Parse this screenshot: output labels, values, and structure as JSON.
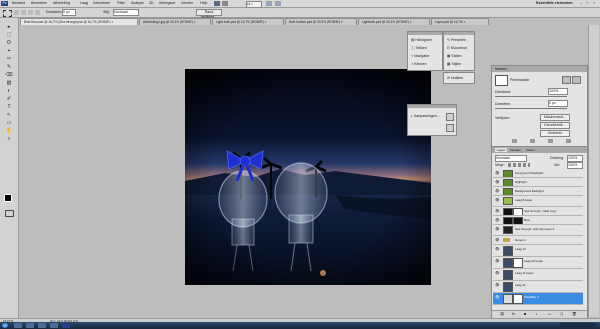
{
  "menubar": {
    "items": [
      "Bestand",
      "Bewerken",
      "Afbeelding",
      "Laag",
      "Selecteren",
      "Filter",
      "Analyse",
      "3D",
      "Weergave",
      "Venster",
      "Help"
    ],
    "workspace": "Essentiële elementen"
  },
  "options": {
    "feather_label": "Doezelen:",
    "feather_value": "0 px",
    "style_label": "Stijl:",
    "style_value": "Normaal",
    "refine_label": "Rand verfijnen..."
  },
  "tabs": [
    {
      "label": "Blue Bow.psd @ 16,7% (Sea through.psd @ 16,7% (RGB/8*) ×"
    },
    {
      "label": "Afbeelding1.jpg @ 33,3% (RGB/8*) ×"
    },
    {
      "label": "Light bulb.psd @ 16,7% (RGB/8*) ×"
    },
    {
      "label": "Bulb bottom.psd @ 33,3% (RGB/8*) ×"
    },
    {
      "label": "Lightbulb.psd @ 33,3% (RGB/8*) ×"
    },
    {
      "label": "Layer.psd @ 16,7% ×"
    }
  ],
  "tools": [
    "▸",
    "⬚",
    "ʘ",
    "⌖",
    "✂",
    "✎",
    "⌫",
    "▧",
    "◐",
    "✐",
    "T",
    "↖",
    "▭",
    "✋",
    "⌕"
  ],
  "mini_panel_a": {
    "items": [
      "Histogram",
      "Tekken",
      "Navigator",
      "Kleuren"
    ]
  },
  "mini_panel_b": {
    "items": [
      "Penselen",
      "Kloonbron",
      "Stalen",
      "Stijlen"
    ]
  },
  "mini_panel_c": {
    "items": [
      "Notities"
    ]
  },
  "adjust_float": {
    "label": "Aanpassingen..."
  },
  "masks_panel": {
    "title": "Maskers",
    "mode": "Pixelmasker",
    "density_label": "Dichtheid:",
    "density_value": "100%",
    "feather_label": "Doezelen:",
    "feather_value": "0 px",
    "refine_label": "Verfijnen:",
    "buttons": [
      "Maskerrand...",
      "Kleurbereik...",
      "Omkeren"
    ]
  },
  "layers_panel": {
    "tabs": [
      "Lagen",
      "Kanalen",
      "Paden"
    ],
    "blend_mode": "Normaal",
    "opacity_label": "Dekking:",
    "opacity_value": "100%",
    "lock_label": "Vergr:",
    "fill_label": "Vul:",
    "fill_value": "100%",
    "layers": [
      {
        "name": "Foreground flashlight",
        "thumb": "#5a8a2a"
      },
      {
        "name": "Highlight",
        "thumb": "#5a8a2a"
      },
      {
        "name": "Background flashlight",
        "thumb": "#5a8a2a"
      },
      {
        "name": "Laag 8 kopie",
        "thumb": "#9bbd42"
      },
      {
        "name": "Sea through: mask copy",
        "thumb": "#111111"
      },
      {
        "name": "Bow",
        "thumb": "#111111"
      },
      {
        "name": "Sea through: with clip kopie 3",
        "thumb": "#222222"
      },
      {
        "name": "Groep 1",
        "thumb": "#4d5e74"
      },
      {
        "name": "Laag 10",
        "thumb": "#3b4a66"
      },
      {
        "name": "Laag 10 kopie",
        "thumb": "#3b4a66"
      },
      {
        "name": "Laag 11 kopie",
        "thumb": "#3b4a66"
      },
      {
        "name": "Laag 11",
        "thumb": "#3b4a66"
      },
      {
        "name": "Pixelfilter 2",
        "thumb": "#dcdcdc"
      }
    ]
  },
  "status": {
    "zoom": "16,67%",
    "doc": "Doc: 22,9 M/324,9 M"
  },
  "colors": {
    "accent": "#3b8de3",
    "bow": "#1d2fd0"
  }
}
